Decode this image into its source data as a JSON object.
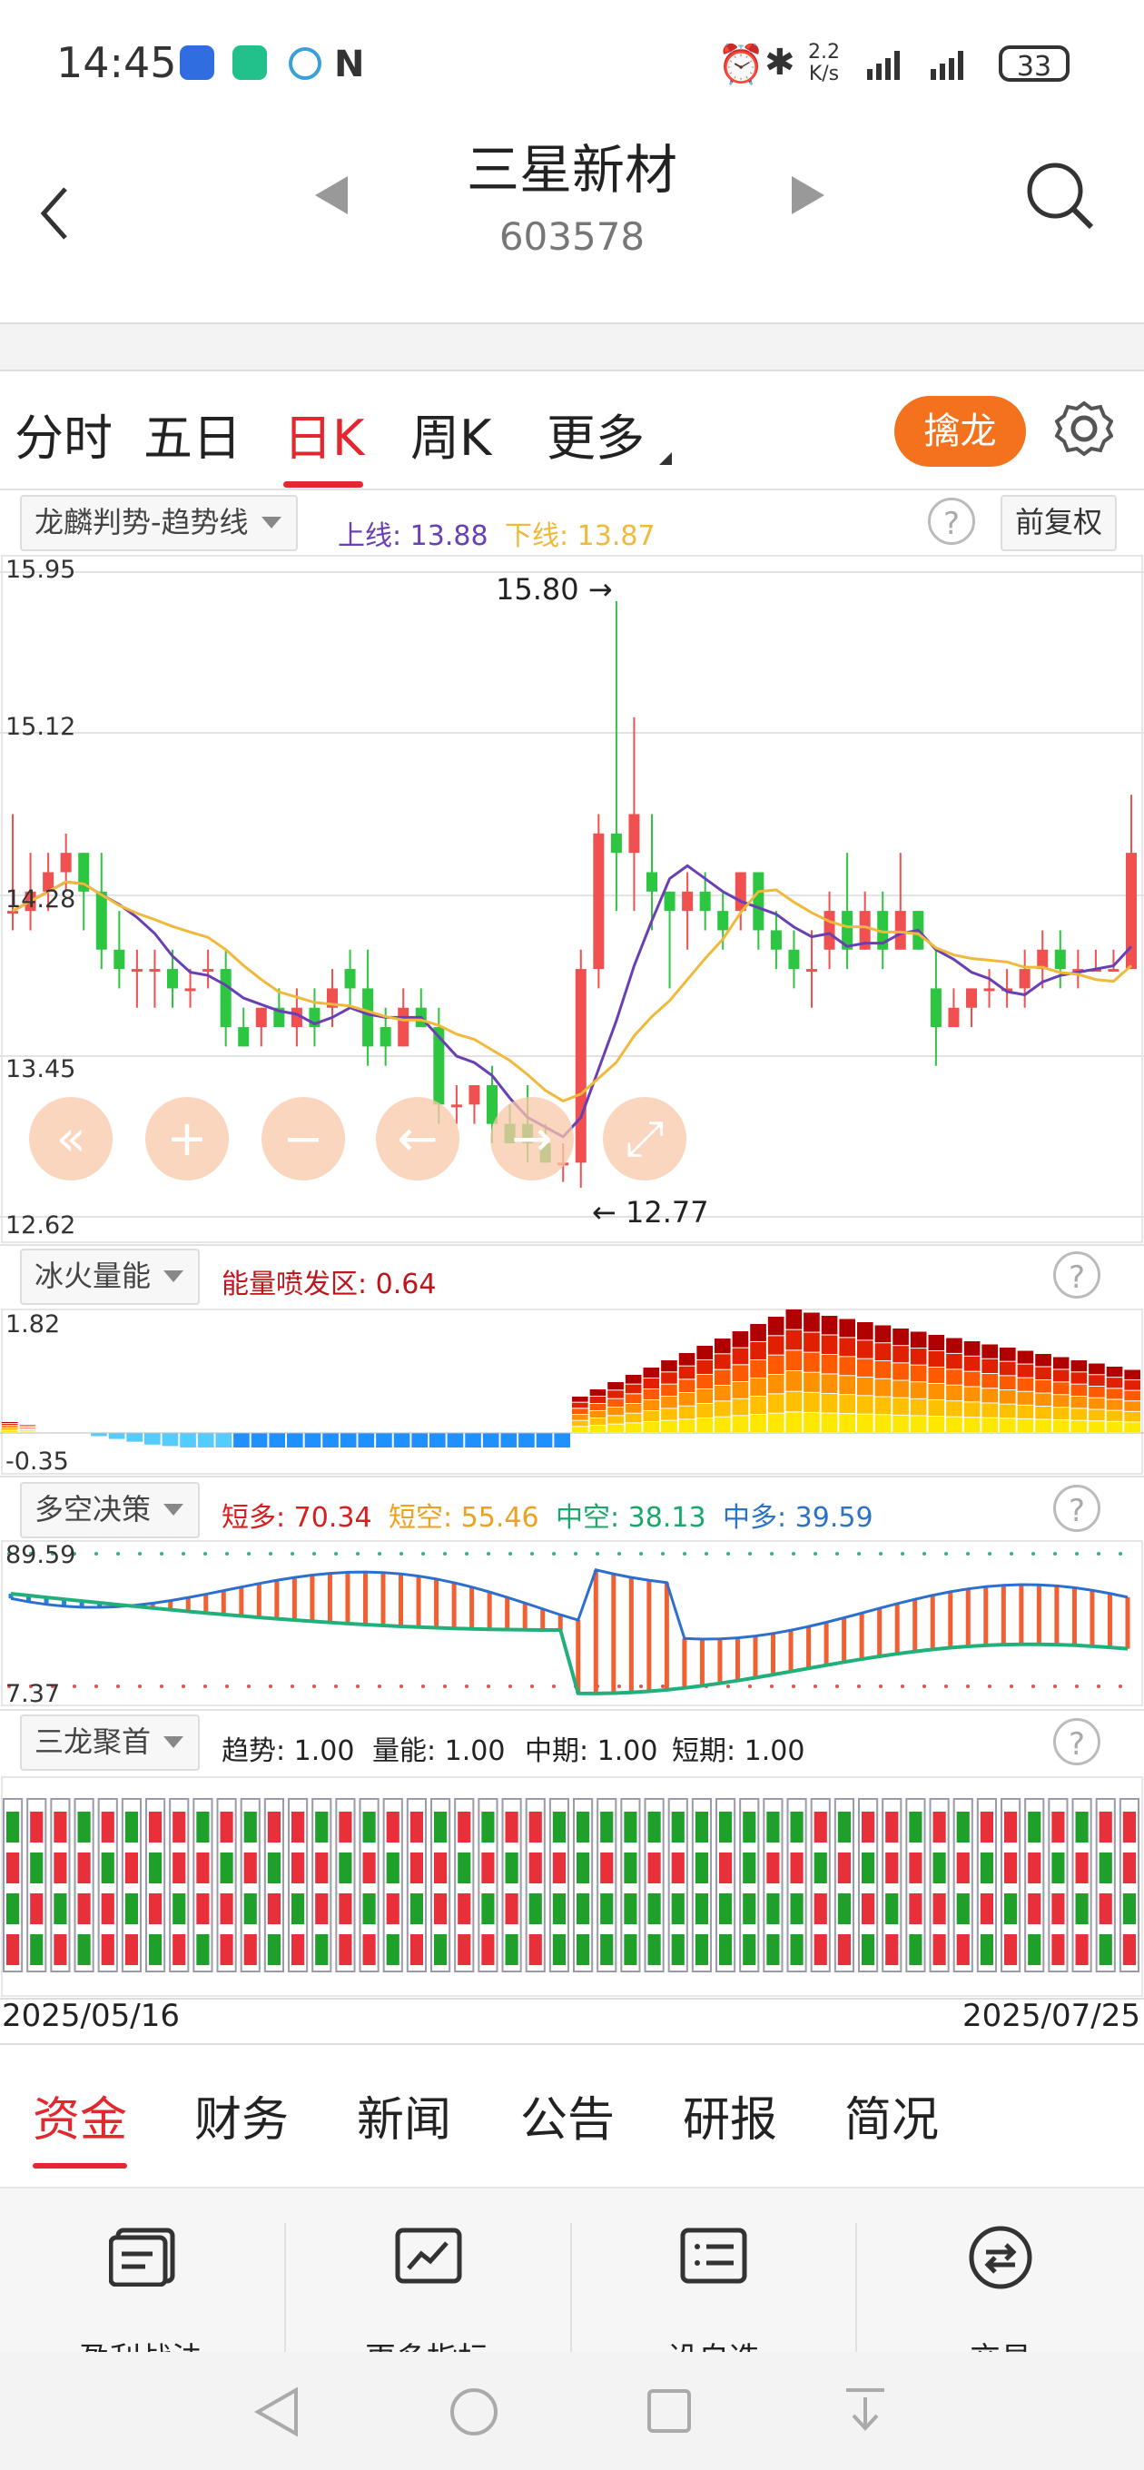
{
  "status_bar": {
    "time": "14:45",
    "net_speed_top": "2.2",
    "net_speed_bottom": "K/s",
    "battery": "33"
  },
  "header": {
    "title": "三星新材",
    "code": "603578"
  },
  "tabs": {
    "items": [
      "分时",
      "五日",
      "日K",
      "周K",
      "更多"
    ],
    "active": "日K",
    "catch_button": "擒龙"
  },
  "main_panel": {
    "selector": "龙麟判势-趋势线",
    "upper_label": "上线: 13.88",
    "lower_label": "下线: 13.87",
    "adjust_button": "前复权",
    "y_ticks": [
      "15.95",
      "15.12",
      "14.28",
      "13.45",
      "12.62"
    ],
    "high_marker": "15.80",
    "low_marker": "12.77"
  },
  "energy_panel": {
    "selector": "冰火量能",
    "label": "能量喷发区: 0.64",
    "y_top": "1.82",
    "y_bottom": "-0.35"
  },
  "decision_panel": {
    "selector": "多空决策",
    "short_long": "短多: 70.34",
    "short_short": "短空: 55.46",
    "mid_short": "中空: 38.13",
    "mid_long": "中多: 39.59",
    "y_top": "89.59",
    "y_bottom": "7.37"
  },
  "dragon_panel": {
    "selector": "三龙聚首",
    "trend": "趋势: 1.00",
    "volume": "量能: 1.00",
    "mid": "中期: 1.00",
    "short": "短期: 1.00"
  },
  "dates": {
    "start": "2025/05/16",
    "end": "2025/07/25"
  },
  "bottom_tabs": {
    "items": [
      "资金",
      "财务",
      "新闻",
      "公告",
      "研报",
      "简况"
    ],
    "active": "资金"
  },
  "bottom_nav": {
    "items": [
      "盈利战法",
      "更多指标",
      "设自选",
      "交易"
    ]
  },
  "colors": {
    "up": "#f05050",
    "down": "#2cc640",
    "accent": "#e4262e",
    "purple": "#6a3fb5",
    "orange": "#f0b93a"
  },
  "chart_data": {
    "type": "candlestick",
    "ylim": [
      12.62,
      15.95
    ],
    "y_ticks": [
      15.95,
      15.12,
      14.28,
      13.45,
      12.62
    ],
    "x_range": [
      "2025/05/16",
      "2025/07/25"
    ],
    "high": 15.8,
    "low": 12.77,
    "candles": [
      [
        14.2,
        14.2,
        14.7,
        14.1
      ],
      [
        14.2,
        14.3,
        14.5,
        14.1
      ],
      [
        14.3,
        14.4,
        14.5,
        14.2
      ],
      [
        14.4,
        14.5,
        14.6,
        14.3
      ],
      [
        14.5,
        14.3,
        14.5,
        14.1
      ],
      [
        14.3,
        14.0,
        14.5,
        13.9
      ],
      [
        14.0,
        13.9,
        14.2,
        13.8
      ],
      [
        13.9,
        13.9,
        14.0,
        13.7
      ],
      [
        13.9,
        13.9,
        14.0,
        13.7
      ],
      [
        13.9,
        13.8,
        14.0,
        13.7
      ],
      [
        13.8,
        13.8,
        13.9,
        13.7
      ],
      [
        13.9,
        13.9,
        14.0,
        13.8
      ],
      [
        13.9,
        13.6,
        14.0,
        13.5
      ],
      [
        13.6,
        13.5,
        13.7,
        13.5
      ],
      [
        13.6,
        13.7,
        13.7,
        13.5
      ],
      [
        13.7,
        13.6,
        13.8,
        13.6
      ],
      [
        13.6,
        13.7,
        13.8,
        13.5
      ],
      [
        13.7,
        13.6,
        13.8,
        13.5
      ],
      [
        13.7,
        13.8,
        13.9,
        13.6
      ],
      [
        13.9,
        13.8,
        14.0,
        13.7
      ],
      [
        13.8,
        13.5,
        14.0,
        13.4
      ],
      [
        13.6,
        13.5,
        13.7,
        13.4
      ],
      [
        13.5,
        13.7,
        13.8,
        13.5
      ],
      [
        13.7,
        13.6,
        13.8,
        13.6
      ],
      [
        13.6,
        13.2,
        13.7,
        13.1
      ],
      [
        13.2,
        13.2,
        13.3,
        13.1
      ],
      [
        13.2,
        13.3,
        13.3,
        13.1
      ],
      [
        13.3,
        13.1,
        13.4,
        13.0
      ],
      [
        13.1,
        13.0,
        13.2,
        13.0
      ],
      [
        13.1,
        13.0,
        13.3,
        12.9
      ],
      [
        13.0,
        12.9,
        13.1,
        12.9
      ],
      [
        12.9,
        12.9,
        13.0,
        12.8
      ],
      [
        12.9,
        13.9,
        14.0,
        12.77
      ],
      [
        13.9,
        14.6,
        14.7,
        13.8
      ],
      [
        14.6,
        14.5,
        15.8,
        14.2
      ],
      [
        14.5,
        14.7,
        15.2,
        14.2
      ],
      [
        14.4,
        14.3,
        14.7,
        14.1
      ],
      [
        14.3,
        14.2,
        14.3,
        13.8
      ],
      [
        14.2,
        14.3,
        14.4,
        14.0
      ],
      [
        14.3,
        14.2,
        14.4,
        14.1
      ],
      [
        14.2,
        14.1,
        14.3,
        14.0
      ],
      [
        14.2,
        14.4,
        14.4,
        14.1
      ],
      [
        14.4,
        14.1,
        14.4,
        14.0
      ],
      [
        14.1,
        14.0,
        14.2,
        13.9
      ],
      [
        14.0,
        13.9,
        14.1,
        13.8
      ],
      [
        13.9,
        13.9,
        14.1,
        13.7
      ],
      [
        14.0,
        14.2,
        14.3,
        13.9
      ],
      [
        14.2,
        14.0,
        14.5,
        13.9
      ],
      [
        14.0,
        14.2,
        14.3,
        14.0
      ],
      [
        14.2,
        14.0,
        14.3,
        13.9
      ],
      [
        14.0,
        14.2,
        14.5,
        14.0
      ],
      [
        14.2,
        14.0,
        14.2,
        14.0
      ],
      [
        13.8,
        13.6,
        14.0,
        13.4
      ],
      [
        13.6,
        13.7,
        13.8,
        13.6
      ],
      [
        13.7,
        13.8,
        13.8,
        13.6
      ],
      [
        13.8,
        13.8,
        13.9,
        13.7
      ],
      [
        13.8,
        13.8,
        13.9,
        13.7
      ],
      [
        13.8,
        13.9,
        14.0,
        13.7
      ],
      [
        13.9,
        14.0,
        14.1,
        13.8
      ],
      [
        14.0,
        13.9,
        14.1,
        13.8
      ],
      [
        13.9,
        13.9,
        14.0,
        13.8
      ],
      [
        13.9,
        13.9,
        14.0,
        13.9
      ],
      [
        13.9,
        13.9,
        14.0,
        13.9
      ],
      [
        13.9,
        14.5,
        14.8,
        13.9
      ]
    ]
  }
}
